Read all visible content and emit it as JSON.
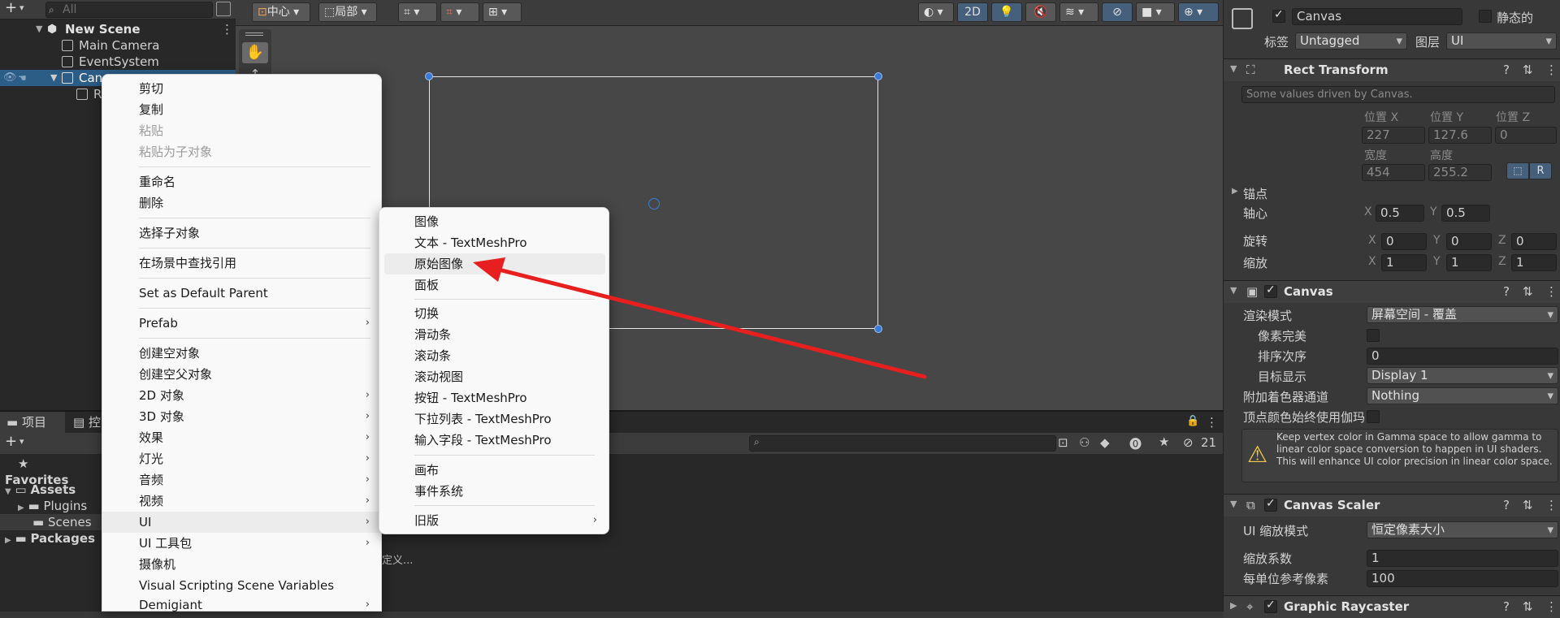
{
  "hierarchy": {
    "search_placeholder": "All",
    "items": [
      {
        "label": "New Scene"
      },
      {
        "label": "Main Camera"
      },
      {
        "label": "EventSystem"
      },
      {
        "label": "Can"
      },
      {
        "label": "R"
      }
    ]
  },
  "scene_toolbar": {
    "pivot_center": "中心",
    "pivot_local": "局部",
    "mode_2d": "2D"
  },
  "context_menu": {
    "items": [
      {
        "label": "剪切",
        "enabled": true
      },
      {
        "label": "复制",
        "enabled": true
      },
      {
        "label": "粘贴",
        "enabled": false
      },
      {
        "label": "粘贴为子对象",
        "enabled": false
      },
      {
        "label": "重命名",
        "enabled": true
      },
      {
        "label": "删除",
        "enabled": true
      },
      {
        "label": "选择子对象",
        "enabled": true
      },
      {
        "label": "在场景中查找引用",
        "enabled": true
      },
      {
        "label": "Set as Default Parent",
        "enabled": true
      },
      {
        "label": "Prefab",
        "enabled": true
      },
      {
        "label": "创建空对象",
        "enabled": true
      },
      {
        "label": "创建空父对象",
        "enabled": true
      },
      {
        "label": "2D 对象",
        "enabled": true
      },
      {
        "label": "3D 对象",
        "enabled": true
      },
      {
        "label": "效果",
        "enabled": true
      },
      {
        "label": "灯光",
        "enabled": true
      },
      {
        "label": "音频",
        "enabled": true
      },
      {
        "label": "视频",
        "enabled": true
      },
      {
        "label": "UI",
        "enabled": true
      },
      {
        "label": "UI 工具包",
        "enabled": true
      },
      {
        "label": "摄像机",
        "enabled": true
      },
      {
        "label": "Visual Scripting Scene Variables",
        "enabled": true
      },
      {
        "label": "Demigiant",
        "enabled": true
      }
    ]
  },
  "ui_submenu": {
    "items": [
      {
        "label": "图像"
      },
      {
        "label": "文本 - TextMeshPro"
      },
      {
        "label": "原始图像"
      },
      {
        "label": "面板"
      },
      {
        "label": "切换"
      },
      {
        "label": "滑动条"
      },
      {
        "label": "滚动条"
      },
      {
        "label": "滚动视图"
      },
      {
        "label": "按钮 - TextMeshPro"
      },
      {
        "label": "下拉列表 - TextMeshPro"
      },
      {
        "label": "输入字段 - TextMeshPro"
      },
      {
        "label": "画布"
      },
      {
        "label": "事件系统"
      },
      {
        "label": "旧版"
      }
    ]
  },
  "project": {
    "tab_project": "项目",
    "tab_console": "控",
    "favorites": "Favorites",
    "assets": "Assets",
    "plugins": "Plugins",
    "scenes": "Scenes",
    "packages": "Packages",
    "hidden_count": "21",
    "truncated_text": "定义..."
  },
  "inspector": {
    "object_name": "Canvas",
    "static_label": "静态的",
    "tag_label": "标签",
    "tag_value": "Untagged",
    "layer_label": "图层",
    "layer_value": "UI",
    "rect_transform": {
      "title": "Rect Transform",
      "driven_note": "Some values driven by Canvas.",
      "pos_x_label": "位置 X",
      "pos_y_label": "位置 Y",
      "pos_z_label": "位置 Z",
      "pos_x": "227",
      "pos_y": "127.6",
      "pos_z": "0",
      "width_label": "宽度",
      "height_label": "高度",
      "width": "454",
      "height": "255.2",
      "anchors_label": "锚点",
      "pivot_label": "轴心",
      "pivot_x": "0.5",
      "pivot_y": "0.5",
      "rotation_label": "旋转",
      "rot_x": "0",
      "rot_y": "0",
      "rot_z": "0",
      "scale_label": "缩放",
      "scale_x": "1",
      "scale_y": "1",
      "scale_z": "1",
      "x": "X",
      "y": "Y",
      "z": "Z",
      "r_btn": "R"
    },
    "canvas": {
      "title": "Canvas",
      "render_mode_label": "渲染模式",
      "render_mode_value": "屏幕空间 - 覆盖",
      "pixel_perfect_label": "像素完美",
      "sort_order_label": "排序次序",
      "sort_order_value": "0",
      "target_display_label": "目标显示",
      "target_display_value": "Display 1",
      "shader_channels_label": "附加着色器通道",
      "shader_channels_value": "Nothing",
      "vertex_color_label": "顶点颜色始终使用伽玛",
      "warning_text": "Keep vertex color in Gamma space to allow gamma to linear color space conversion to happen in UI shaders. This will enhance UI color precision in linear color space."
    },
    "canvas_scaler": {
      "title": "Canvas Scaler",
      "scale_mode_label": "UI 缩放模式",
      "scale_mode_value": "恒定像素大小",
      "scale_factor_label": "缩放系数",
      "scale_factor_value": "1",
      "ref_pixels_label": "每单位参考像素",
      "ref_pixels_value": "100"
    },
    "graphic_raycaster": {
      "title": "Graphic Raycaster"
    }
  },
  "colors": {
    "arrow": "#e81f1f",
    "selection": "#2c5d87",
    "accent": "#46607c"
  }
}
